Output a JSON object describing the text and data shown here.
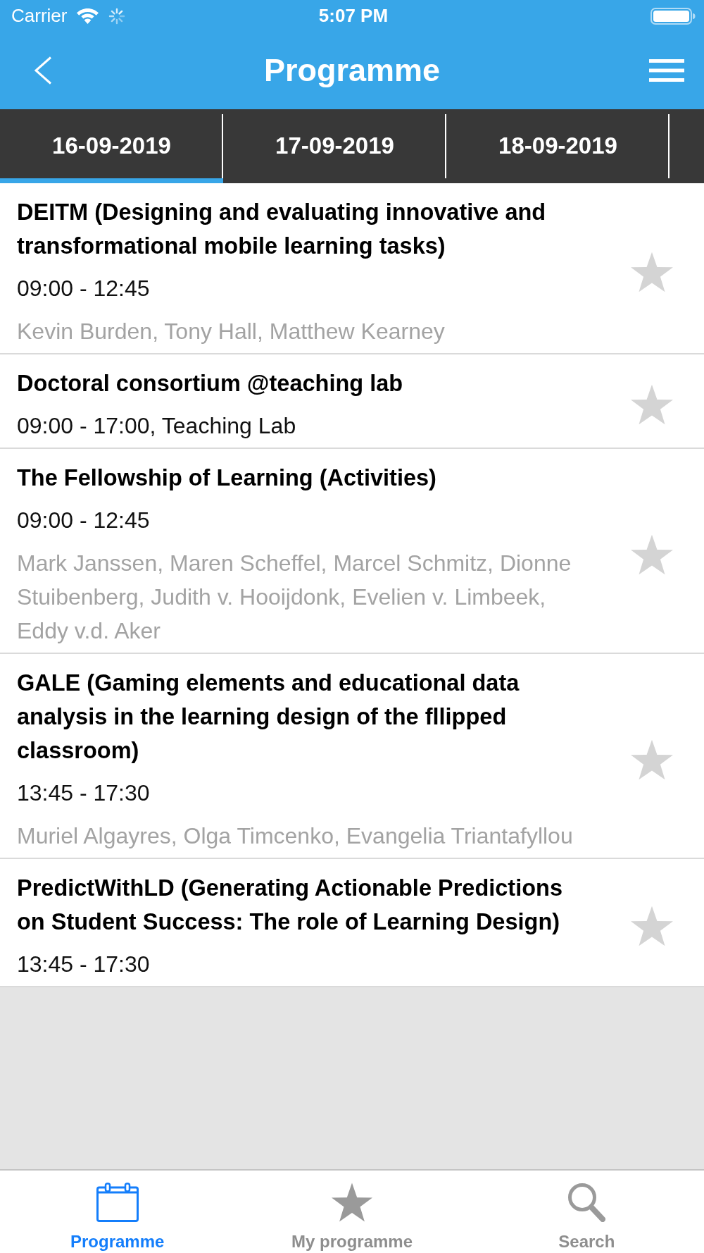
{
  "status_bar": {
    "carrier": "Carrier",
    "time": "5:07 PM"
  },
  "nav_bar": {
    "title": "Programme"
  },
  "date_tabs": [
    {
      "label": "16-09-2019",
      "selected": true
    },
    {
      "label": "17-09-2019",
      "selected": false
    },
    {
      "label": "18-09-2019",
      "selected": false
    }
  ],
  "sessions": [
    {
      "title": "DEITM (Designing and evaluating innovative and transformational mobile learning tasks)",
      "time": "09:00 - 12:45",
      "speakers": "Kevin Burden, Tony Hall, Matthew Kearney",
      "starred": false
    },
    {
      "title": "Doctoral consortium @teaching lab",
      "time": "09:00 - 17:00, Teaching Lab",
      "starred": false
    },
    {
      "title": "The Fellowship of Learning (Activities)",
      "time": "09:00 - 12:45",
      "speakers": "Mark Janssen, Maren Scheffel, Marcel Schmitz, Dionne Stuibenberg, Judith v. Hooijdonk, Evelien v. Limbeek, Eddy v.d. Aker",
      "starred": false
    },
    {
      "title": "GALE (Gaming elements and educational data analysis in the learning design of the fllipped classroom)",
      "time": "13:45 - 17:30",
      "speakers": "Muriel Algayres, Olga Timcenko, Evangelia Triantafyllou",
      "starred": false
    },
    {
      "title": "PredictWithLD (Generating Actionable Predictions on Student Success: The role of Learning Design)",
      "time": "13:45 - 17:30",
      "starred": false
    }
  ],
  "tab_bar": [
    {
      "label": "Programme",
      "selected": true
    },
    {
      "label": "My programme",
      "selected": false
    },
    {
      "label": "Search",
      "selected": false
    }
  ]
}
